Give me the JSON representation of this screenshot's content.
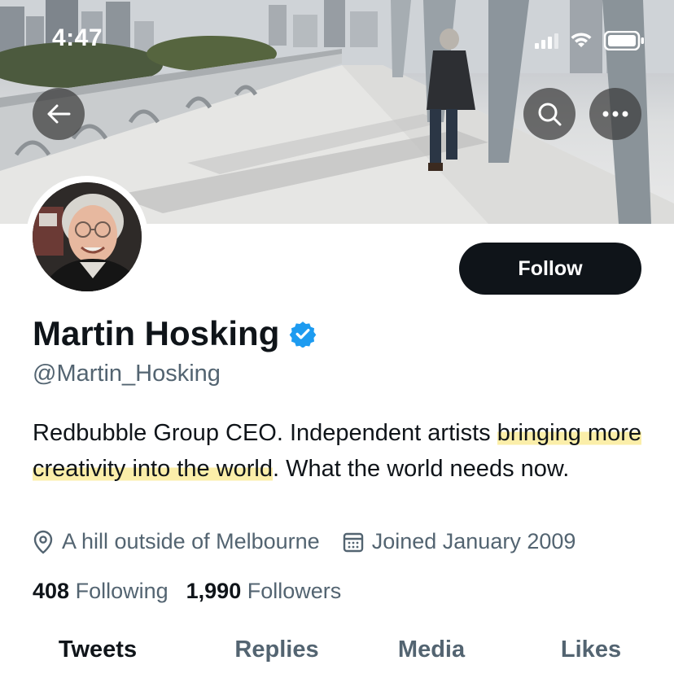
{
  "status_bar": {
    "time": "4:47"
  },
  "header": {
    "back_icon": "arrow-left-icon",
    "search_icon": "search-icon",
    "more_icon": "more-horizontal-icon"
  },
  "profile": {
    "follow_label": "Follow",
    "display_name": "Martin Hosking",
    "verified_icon": "verified-badge-icon",
    "handle": "@Martin_Hosking",
    "bio": {
      "part1": "Redbubble Group CEO. Independent artists ",
      "highlighted": "bringing more creativity into the world",
      "part2": ". What the world needs now."
    },
    "location": "A hill outside of Melbourne",
    "joined": "Joined January 2009",
    "following_count": "408",
    "following_label": "Following",
    "followers_count": "1,990",
    "followers_label": "Followers"
  },
  "tabs": [
    {
      "label": "Tweets",
      "active": true
    },
    {
      "label": "Replies",
      "active": false
    },
    {
      "label": "Media",
      "active": false
    },
    {
      "label": "Likes",
      "active": false
    }
  ],
  "colors": {
    "text_primary": "#0f1419",
    "text_secondary": "#536471",
    "verified_blue": "#1d9bf0",
    "highlight_yellow": "#fae88c"
  }
}
